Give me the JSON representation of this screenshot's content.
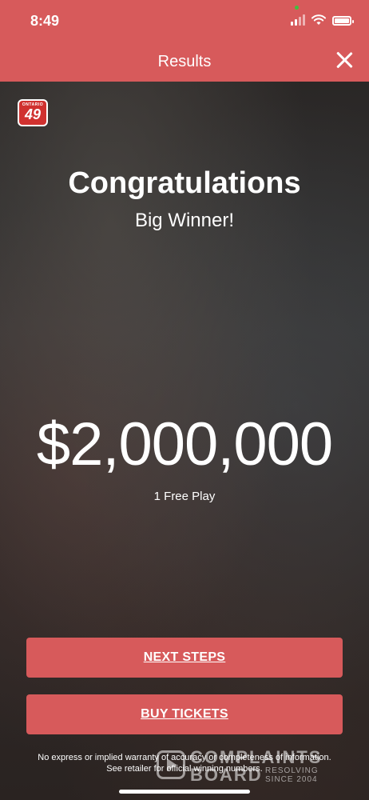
{
  "status_bar": {
    "time": "8:49"
  },
  "header": {
    "title": "Results"
  },
  "logo": {
    "small_text": "ONTARIO",
    "number": "49"
  },
  "main": {
    "headline": "Congratulations",
    "subtitle": "Big Winner!",
    "prize_amount": "$2,000,000",
    "free_play": "1 Free Play"
  },
  "buttons": {
    "next_steps": "NEXT STEPS",
    "buy_tickets": "BUY TICKETS"
  },
  "disclaimer": "No express or implied warranty of accuracy or completeness of information. See retailer for official winning numbers.",
  "watermark": {
    "line1": "COMPLAINTS",
    "line2": "BOARD",
    "side1": "RESOLVING",
    "side2": "SINCE 2004"
  },
  "colors": {
    "accent": "#d75a5b",
    "logo_red": "#d0312f"
  }
}
